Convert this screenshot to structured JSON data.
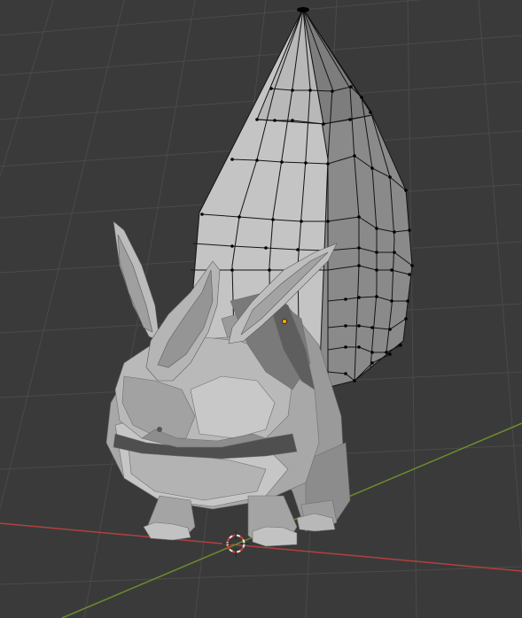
{
  "viewport": {
    "background": "#3a3a3a",
    "grid_color": "#4a4a4a",
    "x_axis_color": "#b2403f",
    "y_axis_color": "#6b8c2e"
  },
  "model": {
    "shade_light": "#c8c8c8",
    "shade_mid": "#a9a9a9",
    "shade_dark": "#7e7e7e",
    "shade_darkest": "#5a5a5a",
    "wire_color": "#141414",
    "vertex_color": "#000000",
    "active_vertex_color": "#ffa500"
  },
  "cursor": {
    "ring_color_a": "#e8e8e8",
    "ring_color_b": "#d13b35"
  }
}
